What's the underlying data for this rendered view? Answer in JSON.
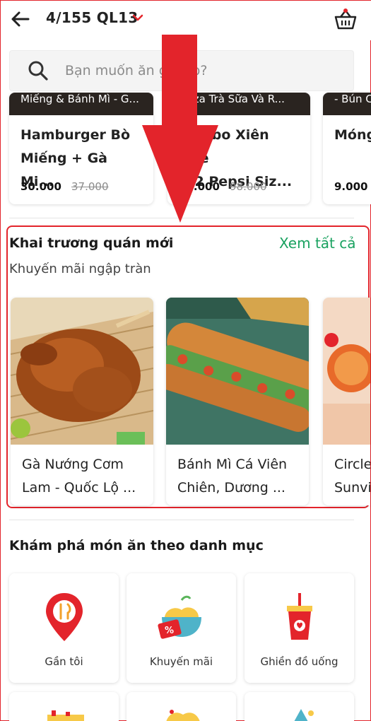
{
  "header": {
    "address": "4/155 QL13",
    "back_icon": "arrow-left-icon",
    "basket_icon": "basket-icon",
    "address_chevron_icon": "chevron-down-icon"
  },
  "search": {
    "placeholder": "Bạn muốn ăn gì nào?",
    "icon": "search-icon"
  },
  "top_carousel": [
    {
      "banner": "Miếng & Bánh Mì - G...",
      "name": "Hamburger Bò\nMiếng  + Gà Mi...",
      "price": "30.000",
      "old_price": "37.000"
    },
    {
      "banner": "Pizza Trà Sữa Và R...",
      "name": "Combo Xiên Que\n+ 2 Pepsi Siz...",
      "price": "79.000",
      "old_price": "98.000"
    },
    {
      "banner": "- Bún C",
      "name": "Móng\n",
      "price": "9.000",
      "old_price": ""
    }
  ],
  "new_restaurants": {
    "title": "Khai trương quán mới",
    "see_all": "Xem tất cả",
    "subtitle": "Khuyến mãi ngập tràn",
    "items": [
      {
        "name": "Gà Nướng Cơm\nLam - Quốc Lộ ..."
      },
      {
        "name": "Bánh Mì Cá Viên\nChiên, Dương ..."
      },
      {
        "name": "Circle\nSunvi"
      }
    ]
  },
  "categories": {
    "title": "Khám phá món ăn theo danh mục",
    "items": [
      {
        "label": "Gần tôi",
        "icon": "map-pin-icon"
      },
      {
        "label": "Khuyến mãi",
        "icon": "discount-bowl-icon"
      },
      {
        "label": "Ghiền đồ uống",
        "icon": "drink-cup-icon"
      }
    ]
  },
  "colors": {
    "accent_red": "#e3242b",
    "link_green": "#1aa260"
  }
}
